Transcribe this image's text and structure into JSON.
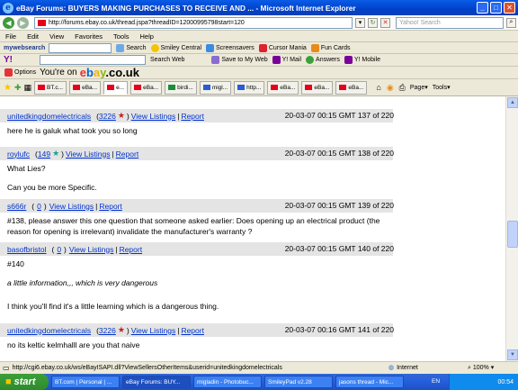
{
  "window": {
    "title": "eBay Forums: BUYERS MAKING PURCHASES TO RECEIVE AND ... - Microsoft Internet Explorer"
  },
  "address": {
    "url": "http://forums.ebay.co.uk/thread.jspa?threadID=12000995798start=120",
    "search_placeholder": "Yahoo! Search"
  },
  "menu": [
    "File",
    "Edit",
    "View",
    "Favorites",
    "Tools",
    "Help"
  ],
  "toolbar1": {
    "brand": "mywebsearch",
    "search": "Search",
    "items": [
      "Smiley Central",
      "Screensavers",
      "Cursor Mania",
      "Fun Cards"
    ]
  },
  "toolbar2": {
    "search_web": "Search Web",
    "items": [
      "Save to My Web",
      "Y! Mail",
      "Answers",
      "Y! Mobile"
    ]
  },
  "toolbar3": {
    "options": "Options",
    "prefix": "You're on",
    "ebay": [
      "e",
      "b",
      "a",
      "y"
    ],
    "suffix": ".co.uk"
  },
  "tabs": [
    "BT.c...",
    "eBa...",
    "e...",
    "eBa...",
    "birdi...",
    "migl...",
    "http...",
    "eBa...",
    "eBa...",
    "eBa..."
  ],
  "toolbar4": {
    "page": "Page",
    "tools": "Tools"
  },
  "posts": [
    {
      "user": "unitedkingdomelectricals",
      "score": "3226",
      "star": "red",
      "view": "View Listings",
      "report": "Report",
      "meta": "20-03-07 00:15 GMT  137 of 220",
      "body": [
        "here he is galuk what took you so long"
      ]
    },
    {
      "user": "roylufc",
      "score": "149",
      "star": "teal",
      "view": "View Listings",
      "report": "Report",
      "meta": "20-03-07 00:15 GMT  138 of 220",
      "body": [
        "What Lies?",
        "Can you be more Specific."
      ]
    },
    {
      "user": "s666r",
      "score": "0",
      "star": "",
      "view": "View Listings",
      "report": "Report",
      "meta": "20-03-07 00:15 GMT  139 of 220",
      "body": [
        "#138, please answer this one question that someone asked earlier: Does opening up an electrical product (the reason for opening is irrelevant) invalidate the manufacturer's warranty ?"
      ]
    },
    {
      "user": "basofbristol",
      "score": "0",
      "star": "",
      "view": "View Listings",
      "report": "Report",
      "meta": "20-03-07 00:15 GMT  140 of 220",
      "body": [
        "#140",
        "a little information,,, which is very dangerous",
        "I think you'll find it's a little learning which is a dangerous thing."
      ]
    },
    {
      "user": "unitedkingdomelectricals",
      "score": "3226",
      "star": "red",
      "view": "View Listings",
      "report": "Report",
      "meta": "20-03-07 00:16 GMT  141 of 220",
      "body": [
        "no its keltic kelmhalll are you that naive"
      ]
    }
  ],
  "status": {
    "url": "http://cgi6.ebay.co.uk/ws/eBayISAPI.dll?ViewSellersOtherItems&userid=unitedkingdomelectricals",
    "zone": "Internet",
    "zoom": "100%"
  },
  "taskbar": {
    "start": "start",
    "tasks": [
      "BT.com | Personal | ...",
      "eBay Forums: BUY...",
      "migladin - Photobuc...",
      "SmileyPad v2.28",
      "jasons thread - Mic..."
    ],
    "lang": "EN",
    "time": "00:54"
  }
}
